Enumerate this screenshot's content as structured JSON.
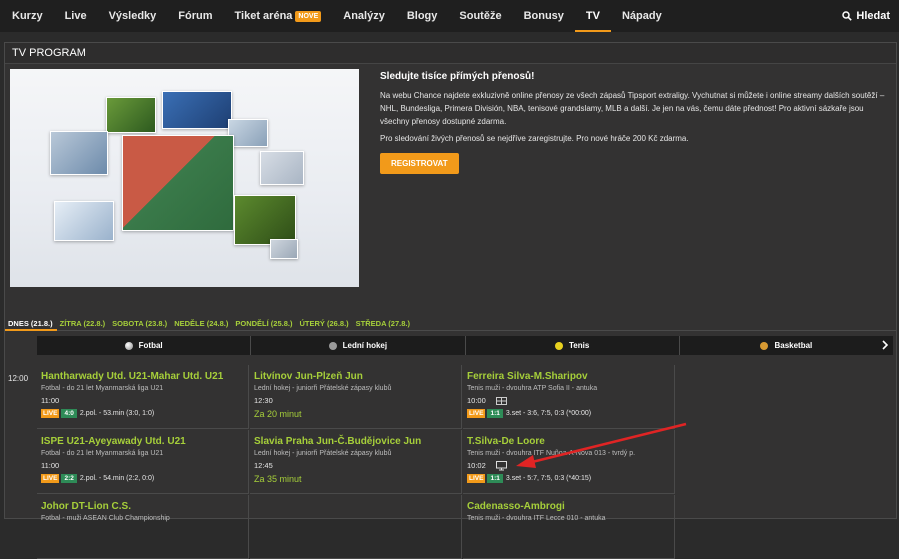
{
  "nav": {
    "items": [
      "Kurzy",
      "Live",
      "Výsledky",
      "Fórum",
      "Tiket aréna",
      "Analýzy",
      "Blogy",
      "Soutěže",
      "Bonusy",
      "TV",
      "Nápady"
    ],
    "new_badge": "NOVE",
    "active": "TV",
    "search_label": "Hledat"
  },
  "panel": {
    "title": "TV PROGRAM",
    "promo_title": "Sledujte tisíce přímých přenosů!",
    "promo_p1": "Na webu Chance najdete exkluzivně online přenosy ze všech zápasů Tipsport extraligy. Vychutnat si můžete i online streamy dalších soutěží – NHL, Bundesliga, Primera División, NBA, tenisové grandslamy, MLB a další. Je jen na vás, čemu dáte přednost! Pro aktivní sázkaře jsou všechny přenosy dostupné zdarma.",
    "promo_p2": "Pro sledování živých přenosů se nejdříve zaregistrujte. Pro nové hráče 200 Kč zdarma.",
    "register_button": "REGISTROVAT"
  },
  "days": [
    "DNES (21.8.)",
    "ZÍTRA (22.8.)",
    "SOBOTA (23.8.)",
    "NEDĚLE (24.8.)",
    "PONDĚLÍ (25.8.)",
    "ÚTERÝ (26.8.)",
    "STŘEDA (27.8.)"
  ],
  "sports": [
    "Fotbal",
    "Lední hokej",
    "Tenis",
    "Basketbal"
  ],
  "time_slot": "12:00",
  "cells": {
    "c1": {
      "title": "Hantharwady Utd. U21-Mahar Utd. U21",
      "sub": "Fotbal - do 21 let Myanmarská liga U21",
      "time": "11:00",
      "live": "LIVE",
      "score": "4:0",
      "result": "2.pol. - 53.min (3:0, 1:0)"
    },
    "c2": {
      "title": "Litvínov Jun-Plzeň Jun",
      "sub": "Lední hokej - juniorři Přátelské zápasy klubů",
      "time": "12:30",
      "note": "Za 20 minut"
    },
    "c3": {
      "title": "Ferreira Silva-M.Sharipov",
      "sub": "Tenis muži - dvouhra ATP Sofia II - antuka",
      "time": "10:00",
      "live": "LIVE",
      "score": "1:1",
      "result": "3.set - 3:6, 7:5, 0:3 (*00:00)"
    },
    "c4": {
      "title": "ISPE U21-Ayeyawady Utd. U21",
      "sub": "Fotbal - do 21 let Myanmarská liga U21",
      "time": "11:00",
      "live": "LIVE",
      "score": "2:2",
      "result": "2.pol. - 54.min (2:2, 0:0)"
    },
    "c5": {
      "title": "Slavia Praha Jun-Č.Budějovice Jun",
      "sub": "Lední hokej - juniorři Přátelské zápasy klubů",
      "time": "12:45",
      "note": "Za 35 minut"
    },
    "c6": {
      "title": "T.Silva-De Loore",
      "sub": "Tenis muži - dvouhra ITF Nuñoa-A-Nova 013 - tvrdý p.",
      "time": "10:02",
      "live": "LIVE",
      "score": "1:1",
      "result": "3.set - 5:7, 7:5, 0:3 (*40:15)"
    },
    "c7": {
      "title": "Johor DT-Lion C.S.",
      "sub": "Fotbal - muži ASEAN Club Championship"
    },
    "c9": {
      "title": "Cadenasso-Ambrogi",
      "sub": "Tenis muži - dvouhra ITF Lecce 010 - antuka"
    }
  },
  "colors": {
    "accent": "#f29a1a",
    "link_green": "#a6cf3a",
    "score_green": "#2e8b57",
    "annotation_arrow": "#e02424"
  }
}
